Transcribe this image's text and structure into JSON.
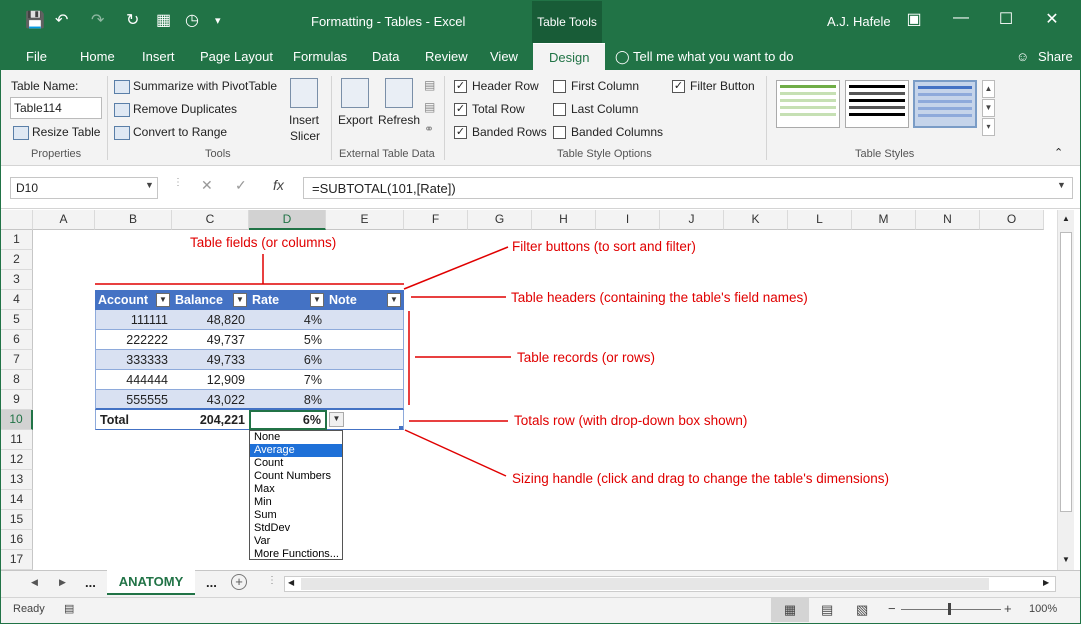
{
  "titlebar": {
    "title": "Formatting - Tables  -  Excel",
    "context_tab": "Table Tools",
    "user": "A.J. Hafele"
  },
  "menu": {
    "items": [
      "File",
      "Home",
      "Insert",
      "Page Layout",
      "Formulas",
      "Data",
      "Review",
      "View",
      "Design"
    ],
    "tell_me": "Tell me what you want to do",
    "share": "Share"
  },
  "ribbon": {
    "properties": {
      "table_name_label": "Table Name:",
      "table_name_value": "Table114",
      "resize": "Resize Table",
      "group": "Properties"
    },
    "tools": {
      "summarize": "Summarize with PivotTable",
      "remove_dup": "Remove Duplicates",
      "convert": "Convert to Range",
      "insert_slicer_1": "Insert",
      "insert_slicer_2": "Slicer",
      "group": "Tools"
    },
    "external": {
      "export": "Export",
      "refresh": "Refresh",
      "group": "External Table Data"
    },
    "options": {
      "header_row": "Header Row",
      "total_row": "Total Row",
      "banded_rows": "Banded Rows",
      "first_column": "First Column",
      "last_column": "Last Column",
      "banded_columns": "Banded Columns",
      "filter_button": "Filter Button",
      "group": "Table Style Options"
    },
    "styles": {
      "group": "Table Styles"
    }
  },
  "formula": {
    "namebox": "D10",
    "formula": "=SUBTOTAL(101,[Rate])"
  },
  "columns": [
    "A",
    "B",
    "C",
    "D",
    "E",
    "F",
    "G",
    "H",
    "I",
    "J",
    "K",
    "L",
    "M",
    "N",
    "O"
  ],
  "rows": [
    "1",
    "2",
    "3",
    "4",
    "5",
    "6",
    "7",
    "8",
    "9",
    "10",
    "11",
    "12",
    "13",
    "14",
    "15",
    "16",
    "17"
  ],
  "table": {
    "headers": [
      "Account",
      "Balance",
      "Rate",
      "Note"
    ],
    "records": [
      [
        "111111",
        "48,820",
        "4%"
      ],
      [
        "222222",
        "49,737",
        "5%"
      ],
      [
        "333333",
        "49,733",
        "6%"
      ],
      [
        "444444",
        "12,909",
        "7%"
      ],
      [
        "555555",
        "43,022",
        "8%"
      ]
    ],
    "total_label": "Total",
    "total_balance": "204,221",
    "total_rate": "6%"
  },
  "dropdown": {
    "items": [
      "None",
      "Average",
      "Count",
      "Count Numbers",
      "Max",
      "Min",
      "Sum",
      "StdDev",
      "Var",
      "More Functions..."
    ],
    "selected": "Average"
  },
  "annotations": {
    "fields": "Table fields (or columns)",
    "filter": "Filter buttons (to sort and filter)",
    "headers": "Table headers (containing the table's field names)",
    "records": "Table records (or rows)",
    "totals": "Totals row (with drop-down box shown)",
    "sizing": "Sizing handle (click and drag to change the table's dimensions)"
  },
  "sheets": {
    "active": "ANATOMY",
    "ellipsis": "..."
  },
  "status": {
    "ready": "Ready",
    "zoom": "100%"
  },
  "colors": {
    "excel_green": "#217346",
    "table_header": "#4472c4",
    "band": "#d9e1f2",
    "annotation": "#e00000"
  }
}
